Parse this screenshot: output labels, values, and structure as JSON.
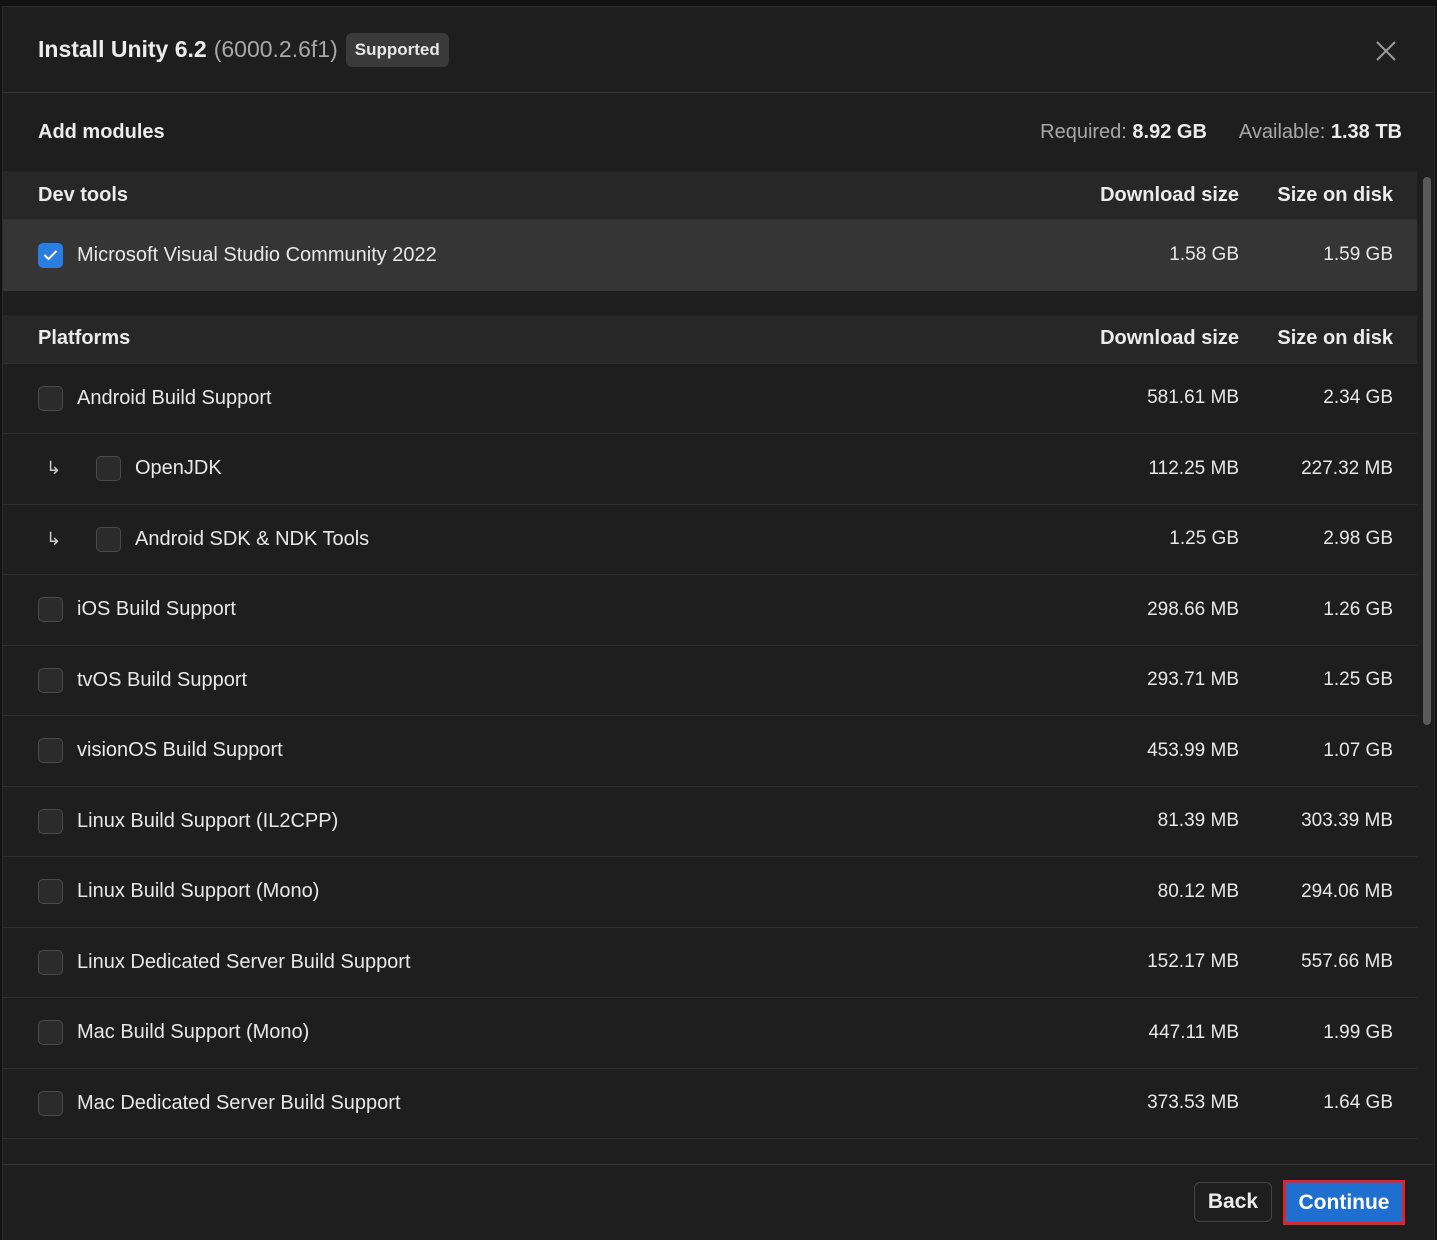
{
  "dialog": {
    "title": "Install Unity 6.2",
    "version": "(6000.2.6f1)",
    "badge": "Supported"
  },
  "subheader": {
    "title": "Add modules",
    "required_label": "Required:",
    "required_value": "8.92 GB",
    "available_label": "Available:",
    "available_value": "1.38 TB"
  },
  "dev_tools": {
    "header": "Dev tools",
    "col_download": "Download size",
    "col_disk": "Size on disk",
    "items": [
      {
        "label": "Microsoft Visual Studio Community 2022",
        "download": "1.58 GB",
        "disk": "1.59 GB",
        "checked": true
      }
    ]
  },
  "platforms": {
    "header": "Platforms",
    "col_download": "Download size",
    "col_disk": "Size on disk",
    "items": [
      {
        "label": "Android Build Support",
        "download": "581.61 MB",
        "disk": "2.34 GB"
      },
      {
        "label": "OpenJDK",
        "download": "112.25 MB",
        "disk": "227.32 MB",
        "child": true
      },
      {
        "label": "Android SDK & NDK Tools",
        "download": "1.25 GB",
        "disk": "2.98 GB",
        "child": true
      },
      {
        "label": "iOS Build Support",
        "download": "298.66 MB",
        "disk": "1.26 GB"
      },
      {
        "label": "tvOS Build Support",
        "download": "293.71 MB",
        "disk": "1.25 GB"
      },
      {
        "label": "visionOS Build Support",
        "download": "453.99 MB",
        "disk": "1.07 GB"
      },
      {
        "label": "Linux Build Support (IL2CPP)",
        "download": "81.39 MB",
        "disk": "303.39 MB"
      },
      {
        "label": "Linux Build Support (Mono)",
        "download": "80.12 MB",
        "disk": "294.06 MB"
      },
      {
        "label": "Linux Dedicated Server Build Support",
        "download": "152.17 MB",
        "disk": "557.66 MB"
      },
      {
        "label": "Mac Build Support (Mono)",
        "download": "447.11 MB",
        "disk": "1.99 GB"
      },
      {
        "label": "Mac Dedicated Server Build Support",
        "download": "373.53 MB",
        "disk": "1.64 GB"
      }
    ]
  },
  "footer": {
    "back_label": "Back",
    "continue_label": "Continue"
  },
  "icons": {
    "close": "close-icon",
    "check": "checkmark-icon",
    "child_arrow": "child-arrow-icon"
  },
  "colors": {
    "accent": "#1f6fd0",
    "checkbox_checked": "#2a7de1",
    "highlight_border": "#e0242e"
  }
}
